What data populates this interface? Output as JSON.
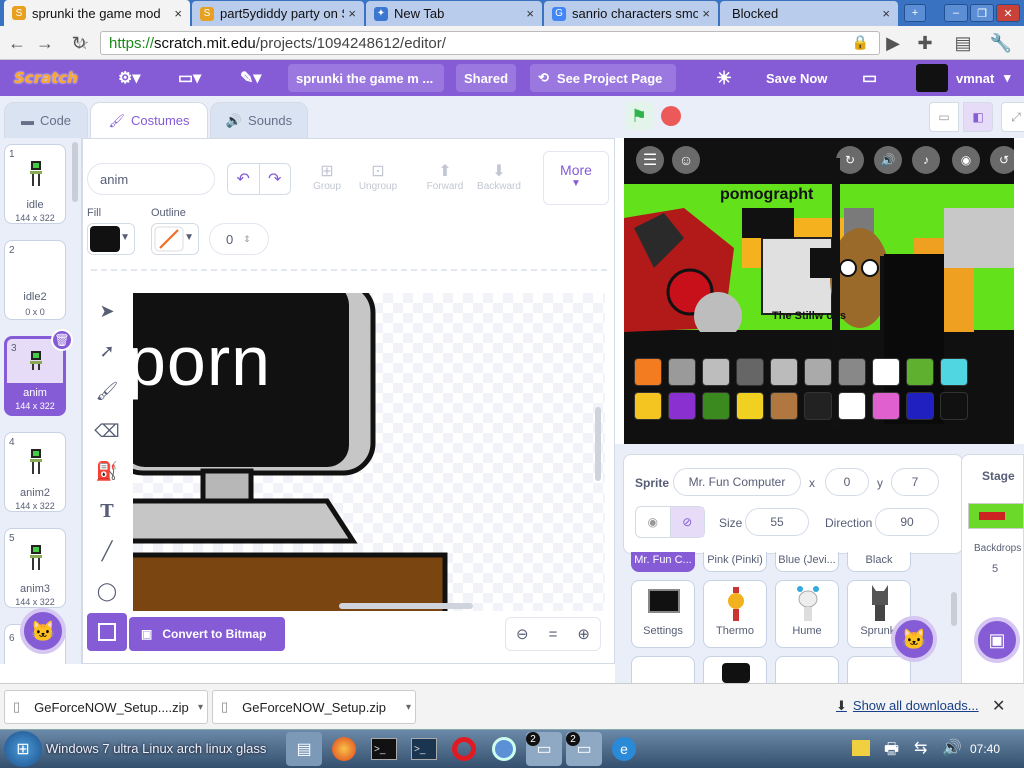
{
  "browser": {
    "tabs": [
      {
        "title": "sprunki the game mod",
        "active": true,
        "fav_color": "#e8a020"
      },
      {
        "title": "part5ydiddy party on Sc",
        "fav_color": "#e8a020"
      },
      {
        "title": "New Tab",
        "fav_color": "#3b77d0"
      },
      {
        "title": "sanrio characters smok",
        "fav_color": "#4285f4"
      },
      {
        "title": "Blocked",
        "fav_color": "#777777"
      }
    ],
    "close_glyph": "×",
    "url_scheme": "https://",
    "url_domain": "scratch.mit.edu",
    "url_path": "/projects/1094248612/editor/"
  },
  "menubar": {
    "logo": "Scratch",
    "project_title": "sprunki the game m ...",
    "shared": "Shared",
    "see_project": "See Project Page",
    "save_now": "Save Now",
    "username": "vmnat"
  },
  "tabs": {
    "code": "Code",
    "costumes": "Costumes",
    "sounds": "Sounds"
  },
  "costumes": [
    {
      "num": "1",
      "name": "idle",
      "size": "144 x 322"
    },
    {
      "num": "2",
      "name": "idle2",
      "size": "0 x 0"
    },
    {
      "num": "3",
      "name": "anim",
      "size": "144 x 322",
      "selected": true
    },
    {
      "num": "4",
      "name": "anim2",
      "size": "144 x 322"
    },
    {
      "num": "5",
      "name": "anim3",
      "size": "144 x 322"
    },
    {
      "num": "6"
    }
  ],
  "paint": {
    "costume_name": "anim",
    "group": "Group",
    "ungroup": "Ungroup",
    "forward": "Forward",
    "backward": "Backward",
    "more": "More",
    "fill_label": "Fill",
    "outline_label": "Outline",
    "outline_width": "0",
    "fill_color": "#111111",
    "canvas_text": "porn",
    "convert": "Convert to Bitmap",
    "zoom_reset": "="
  },
  "stage": {
    "title_text": "pomographt",
    "caption_text": "The Stillw     ons",
    "icon_colors": [
      "#f47c20",
      "#9a9a9a",
      "#bdbdbd",
      "#666666",
      "#bbbbbb",
      "#aaaaaa",
      "#888888",
      "#ffffff",
      "#60b030",
      "#4fd6e0",
      "#f4c420",
      "#8a30d0",
      "#3a8a20",
      "#f0d020",
      "#b07840",
      "#222222",
      "#ffffff",
      "#e060d0",
      "#2020c0",
      "#111111"
    ]
  },
  "sprite": {
    "label": "Sprite",
    "name": "Mr. Fun Computer",
    "x_label": "x",
    "x": "0",
    "y_label": "y",
    "y": "7",
    "size_label": "Size",
    "size": "55",
    "direction_label": "Direction",
    "direction": "90",
    "top_row": [
      "Mr. Fun C...",
      "Pink (Pinki)",
      "Blue (Jevi...",
      "Black"
    ],
    "tiles": [
      "Settings",
      "Thermo",
      "Hume",
      "Sprunki"
    ]
  },
  "stage_panel": {
    "label": "Stage",
    "backdrops": "Backdrops",
    "count": "5"
  },
  "downloads": {
    "items": [
      "GeForceNOW_Setup....zip",
      "GeForceNOW_Setup.zip"
    ],
    "show_all": "Show all downloads..."
  },
  "taskbar": {
    "title": "Windows 7 ultra Linux arch linux glass",
    "time": "07:40",
    "badges": [
      "2",
      "2"
    ]
  }
}
